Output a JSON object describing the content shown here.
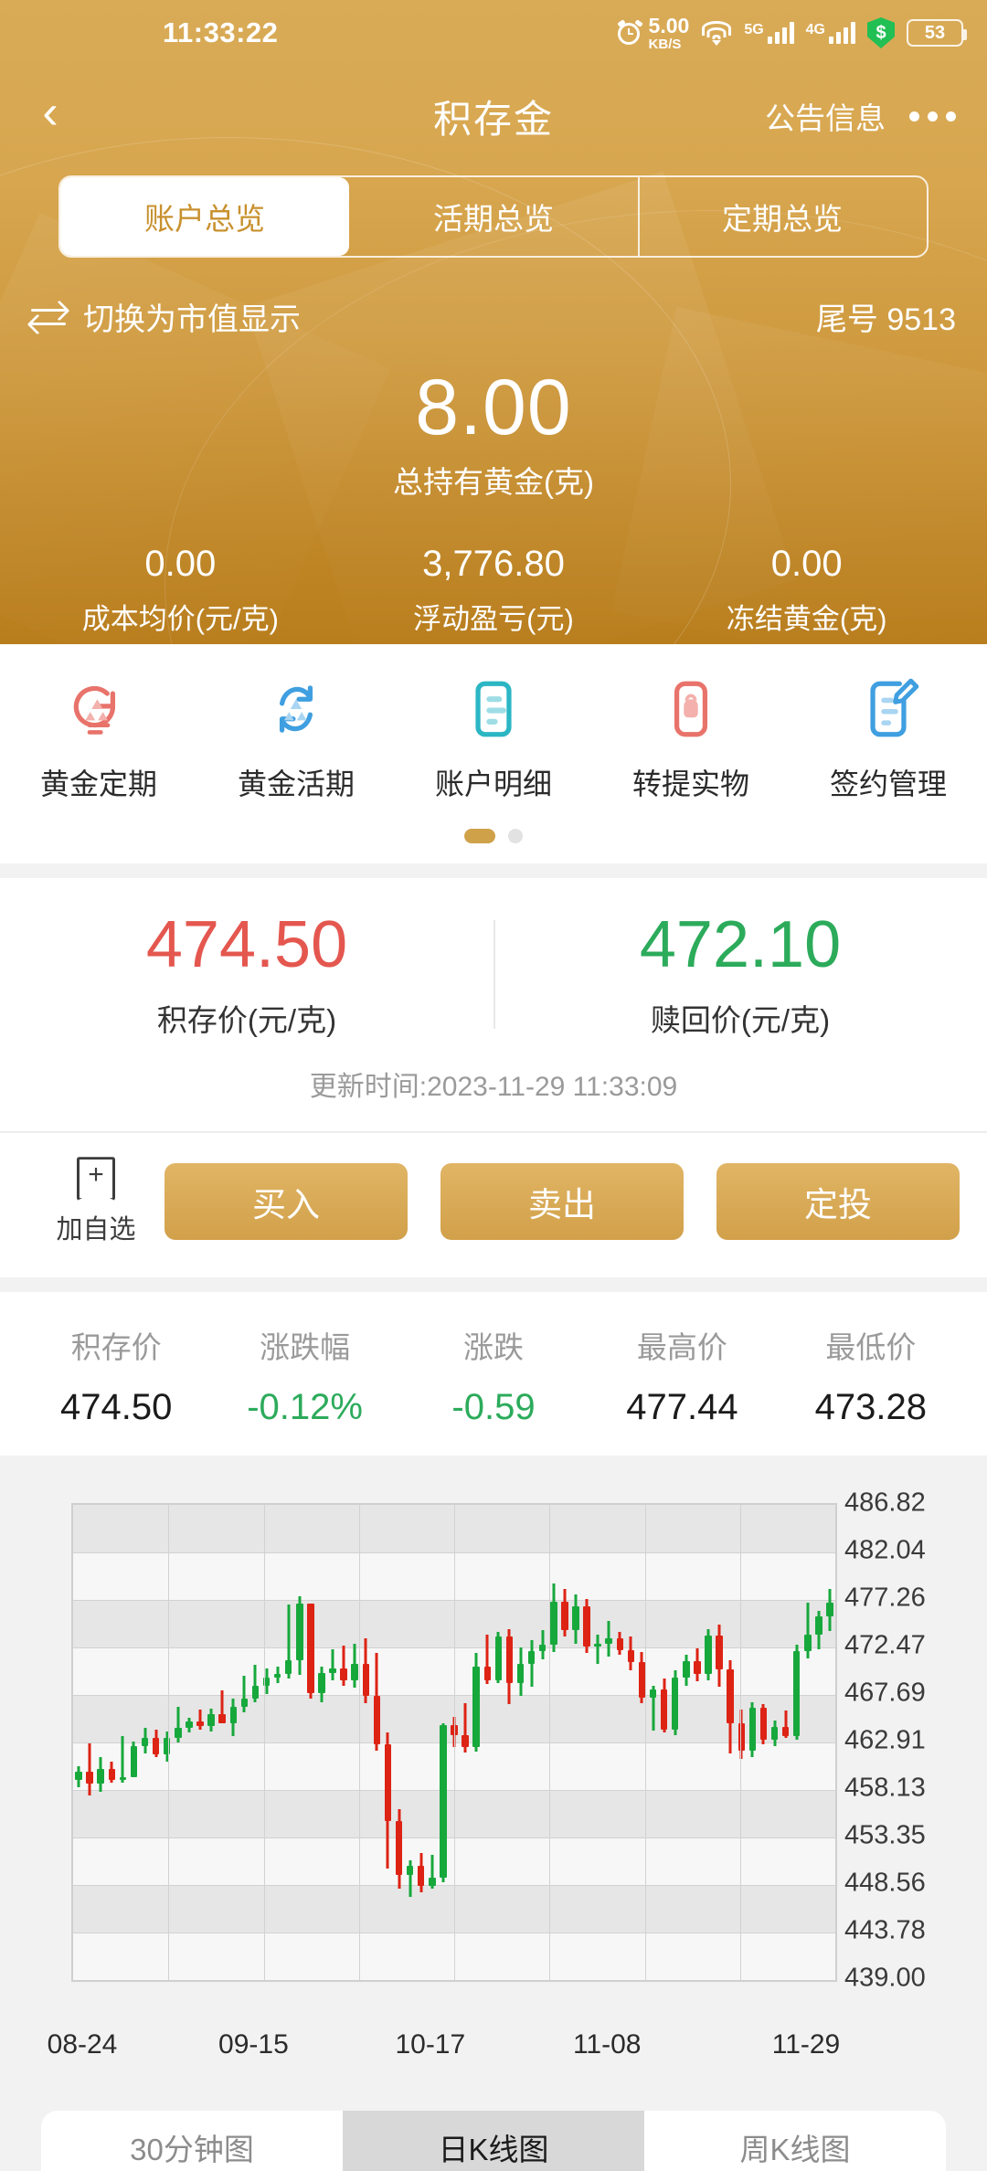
{
  "status_bar": {
    "time": "11:33:22",
    "net_speed_value": "5.00",
    "net_speed_unit": "KB/S",
    "signal_5g_label": "5G",
    "signal_4g_label": "4G",
    "shield_glyph": "$",
    "battery_percent": "53",
    "icons": [
      "alarm-icon",
      "wifi-icon",
      "signal-5g-icon",
      "signal-4g-icon",
      "shield-icon",
      "battery-icon"
    ]
  },
  "nav": {
    "back_glyph": "‹",
    "title": "积存金",
    "notice_label": "公告信息",
    "more_label": "more-options"
  },
  "tabs": [
    {
      "label": "账户总览",
      "active": true
    },
    {
      "label": "活期总览",
      "active": false
    },
    {
      "label": "定期总览",
      "active": false
    }
  ],
  "switch_row": {
    "toggle_label": "切换为市值显示",
    "account_suffix": "尾号 9513"
  },
  "balance": {
    "amount": "8.00",
    "label": "总持有黄金(克)"
  },
  "summary_stats": [
    {
      "value": "0.00",
      "label": "成本均价(元/克)"
    },
    {
      "value": "3,776.80",
      "label": "浮动盈亏(元)"
    },
    {
      "value": "0.00",
      "label": "冻结黄金(克)"
    }
  ],
  "quick_actions": [
    {
      "label": "黄金定期",
      "icon": "gold-fixed-term-icon",
      "color": "#e8736b"
    },
    {
      "label": "黄金活期",
      "icon": "gold-demand-icon",
      "color": "#3f9fe0"
    },
    {
      "label": "账户明细",
      "icon": "account-details-icon",
      "color": "#2bb6c4"
    },
    {
      "label": "转提实物",
      "icon": "physical-delivery-icon",
      "color": "#e8736b"
    },
    {
      "label": "签约管理",
      "icon": "contract-management-icon",
      "color": "#3f9fe0"
    }
  ],
  "page_dots": {
    "count": 2,
    "active_index": 0
  },
  "quote": {
    "buy": {
      "value": "474.50",
      "label": "积存价(元/克)"
    },
    "sell": {
      "value": "472.10",
      "label": "赎回价(元/克)"
    },
    "updated": "更新时间:2023-11-29 11:33:09"
  },
  "actions": {
    "add_favorite": {
      "label": "加自选",
      "icon": "bookmark-plus-icon",
      "glyph": "+"
    },
    "buy_label": "买入",
    "sell_label": "卖出",
    "plan_label": "定投"
  },
  "stat_table": {
    "headers": [
      "积存价",
      "涨跌幅",
      "涨跌",
      "最高价",
      "最低价"
    ],
    "values": [
      "474.50",
      "-0.12%",
      "-0.59",
      "477.44",
      "473.28"
    ],
    "down_indices": [
      1,
      2
    ]
  },
  "chart_tabs": [
    {
      "label": "30分钟图",
      "active": false
    },
    {
      "label": "日K线图",
      "active": true
    },
    {
      "label": "周K线图",
      "active": false
    }
  ],
  "colors": {
    "gold_top": "#d9ab57",
    "gold_bottom": "#b87d1c",
    "up_green": "#17a83c",
    "down_red": "#dd2314",
    "buy_red": "#e4574f",
    "sell_green": "#2cab5b"
  },
  "chart_data": {
    "type": "candlestick",
    "title": "",
    "xlabel": "",
    "ylabel": "",
    "ylim": [
      439.0,
      486.82
    ],
    "grid": true,
    "y_ticks": [
      486.82,
      482.04,
      477.26,
      472.47,
      467.69,
      462.91,
      458.13,
      453.35,
      448.56,
      443.78,
      439.0
    ],
    "x_ticks": [
      "08-24",
      "09-15",
      "10-17",
      "11-08",
      "11-29"
    ],
    "x_tick_positions": [
      0,
      16,
      32,
      48,
      64
    ],
    "series_name": "日K线图",
    "up_color": "#17a83c",
    "down_color": "#dd2314",
    "ohlc": [
      [
        459.2,
        460.5,
        458.4,
        460.0
      ],
      [
        460.0,
        462.8,
        457.6,
        458.8
      ],
      [
        458.8,
        461.5,
        458.0,
        460.3
      ],
      [
        460.3,
        461.0,
        458.9,
        459.2
      ],
      [
        459.2,
        463.6,
        458.9,
        459.4
      ],
      [
        459.4,
        463.0,
        461.4,
        462.6
      ],
      [
        462.6,
        464.4,
        461.8,
        463.4
      ],
      [
        463.4,
        464.2,
        461.5,
        461.7
      ],
      [
        461.7,
        464.0,
        461.0,
        463.4
      ],
      [
        463.4,
        466.5,
        462.9,
        464.4
      ],
      [
        464.4,
        465.4,
        463.9,
        465.0
      ],
      [
        465.0,
        466.2,
        464.2,
        464.6
      ],
      [
        464.6,
        466.3,
        464.0,
        465.8
      ],
      [
        465.8,
        468.2,
        465.3,
        464.9
      ],
      [
        464.9,
        467.3,
        463.6,
        466.5
      ],
      [
        466.5,
        469.6,
        466.0,
        467.3
      ],
      [
        467.3,
        470.7,
        467.0,
        468.6
      ],
      [
        468.6,
        470.4,
        467.8,
        469.5
      ],
      [
        469.5,
        470.6,
        468.9,
        469.8
      ],
      [
        469.8,
        476.8,
        469.4,
        471.2
      ],
      [
        471.2,
        477.6,
        469.7,
        476.9
      ],
      [
        476.9,
        471.5,
        467.3,
        467.9
      ],
      [
        467.9,
        470.6,
        467.0,
        469.9
      ],
      [
        469.9,
        472.3,
        469.2,
        470.4
      ],
      [
        470.4,
        472.7,
        468.6,
        469.2
      ],
      [
        469.2,
        472.9,
        468.4,
        470.8
      ],
      [
        470.8,
        473.4,
        466.9,
        467.6
      ],
      [
        467.6,
        471.9,
        462.1,
        462.7
      ],
      [
        462.7,
        463.9,
        450.2,
        455.0
      ],
      [
        455.0,
        456.2,
        448.2,
        449.6
      ],
      [
        449.6,
        451.1,
        447.4,
        450.5
      ],
      [
        450.5,
        451.8,
        447.8,
        448.5
      ],
      [
        448.5,
        451.6,
        448.2,
        449.3
      ],
      [
        449.3,
        464.9,
        448.9,
        464.7
      ],
      [
        464.7,
        465.5,
        462.5,
        463.7
      ],
      [
        463.7,
        466.9,
        461.9,
        462.5
      ],
      [
        462.5,
        471.9,
        462.0,
        470.6
      ],
      [
        470.6,
        473.8,
        468.8,
        469.2
      ],
      [
        469.2,
        474.1,
        468.9,
        473.6
      ],
      [
        473.6,
        474.3,
        466.8,
        468.9
      ],
      [
        468.9,
        472.5,
        467.6,
        470.8
      ],
      [
        470.8,
        473.2,
        468.5,
        472.1
      ],
      [
        472.1,
        474.2,
        471.3,
        472.8
      ],
      [
        472.8,
        478.9,
        472.0,
        477.1
      ],
      [
        477.1,
        478.4,
        473.6,
        474.2
      ],
      [
        474.2,
        477.8,
        472.9,
        476.6
      ],
      [
        476.6,
        477.4,
        471.9,
        472.6
      ],
      [
        472.6,
        473.8,
        470.8,
        472.9
      ],
      [
        472.9,
        475.2,
        471.6,
        473.4
      ],
      [
        473.4,
        474.1,
        471.8,
        472.2
      ],
      [
        472.2,
        473.6,
        470.2,
        471.0
      ],
      [
        471.0,
        472.0,
        466.9,
        467.4
      ],
      [
        467.4,
        468.6,
        464.1,
        468.3
      ],
      [
        468.3,
        469.4,
        463.9,
        464.2
      ],
      [
        464.2,
        470.2,
        463.7,
        469.5
      ],
      [
        469.5,
        471.8,
        468.6,
        471.1
      ],
      [
        471.1,
        472.4,
        469.1,
        469.8
      ],
      [
        469.8,
        474.3,
        469.2,
        473.7
      ],
      [
        473.7,
        474.8,
        468.5,
        470.3
      ],
      [
        470.3,
        471.2,
        461.8,
        464.9
      ],
      [
        464.9,
        466.2,
        461.3,
        462.1
      ],
      [
        462.1,
        467.0,
        461.5,
        466.4
      ],
      [
        466.4,
        466.8,
        462.7,
        463.2
      ],
      [
        463.2,
        465.1,
        462.6,
        464.5
      ],
      [
        464.5,
        466.1,
        463.4,
        463.6
      ],
      [
        463.6,
        472.8,
        463.2,
        472.1
      ],
      [
        472.1,
        477.0,
        471.4,
        473.8
      ],
      [
        473.8,
        476.2,
        472.3,
        475.6
      ],
      [
        475.6,
        478.4,
        474.1,
        477.0
      ]
    ]
  }
}
